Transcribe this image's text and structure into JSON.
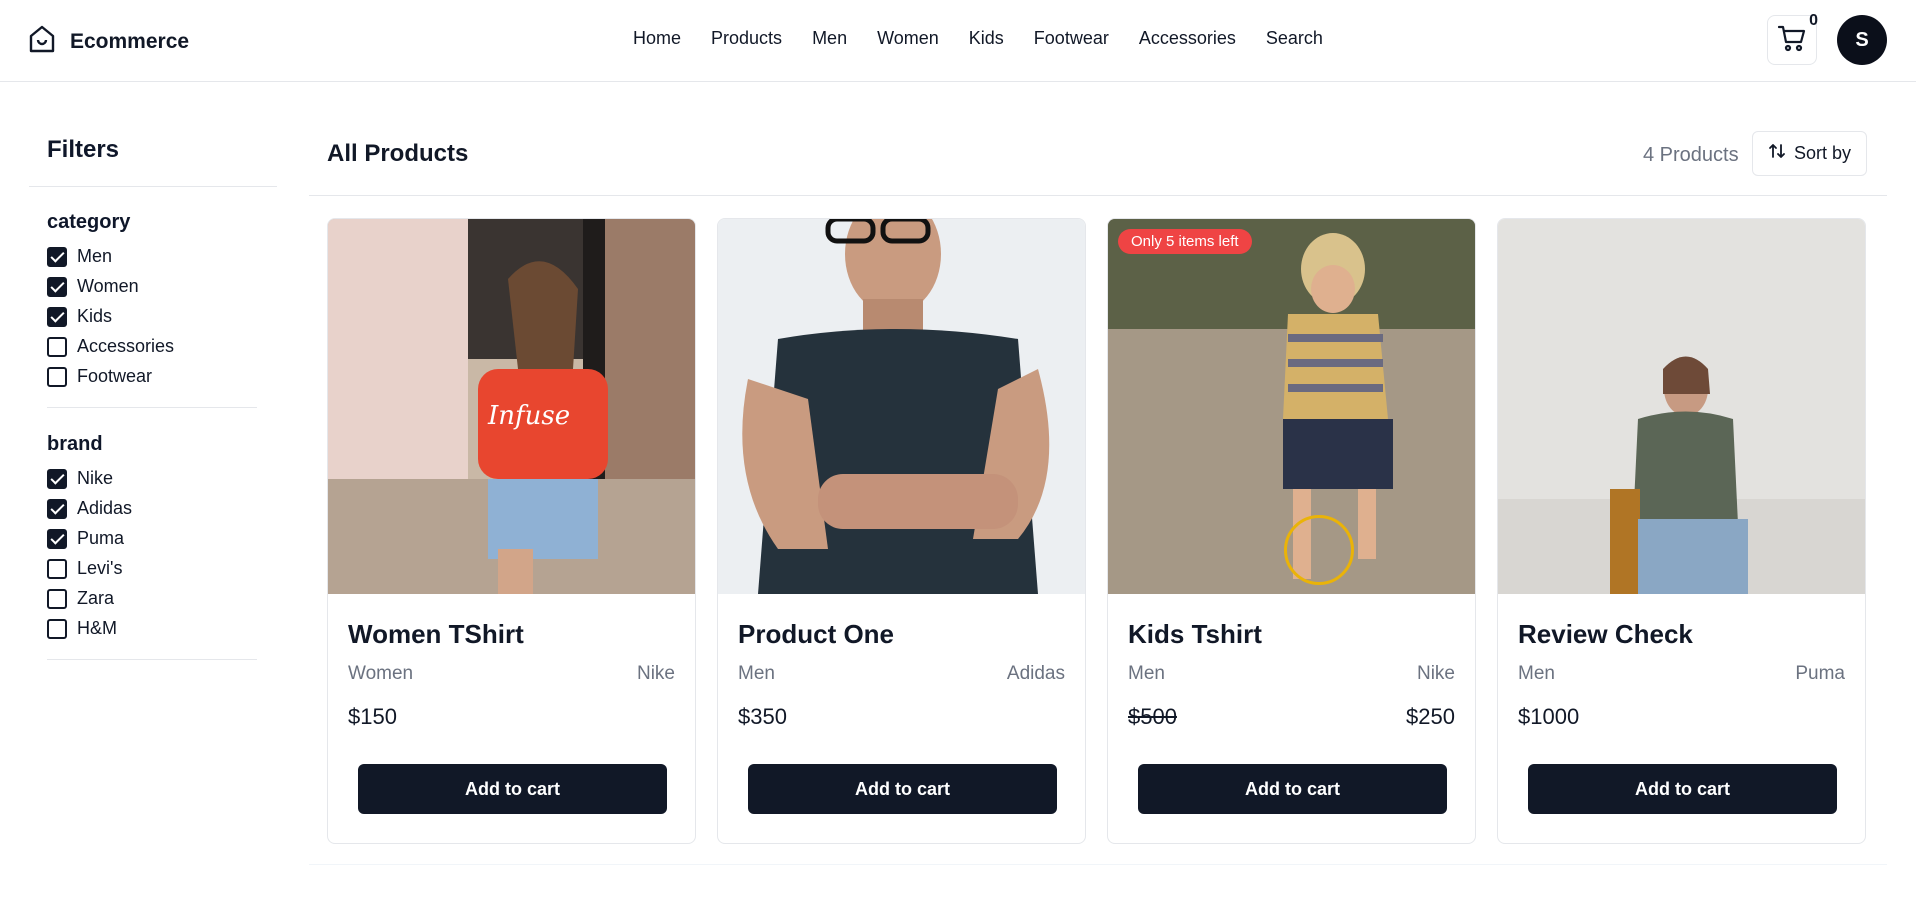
{
  "header": {
    "brand": "Ecommerce",
    "nav": [
      "Home",
      "Products",
      "Men",
      "Women",
      "Kids",
      "Footwear",
      "Accessories",
      "Search"
    ],
    "cart_count": "0",
    "avatar_initial": "S"
  },
  "sidebar": {
    "title": "Filters",
    "category": {
      "title": "category",
      "options": [
        {
          "label": "Men",
          "checked": true
        },
        {
          "label": "Women",
          "checked": true
        },
        {
          "label": "Kids",
          "checked": true
        },
        {
          "label": "Accessories",
          "checked": false
        },
        {
          "label": "Footwear",
          "checked": false
        }
      ]
    },
    "brand": {
      "title": "brand",
      "options": [
        {
          "label": "Nike",
          "checked": true
        },
        {
          "label": "Adidas",
          "checked": true
        },
        {
          "label": "Puma",
          "checked": true
        },
        {
          "label": "Levi's",
          "checked": false
        },
        {
          "label": "Zara",
          "checked": false
        },
        {
          "label": "H&M",
          "checked": false
        }
      ]
    }
  },
  "main": {
    "title": "All Products",
    "count": "4 Products",
    "sort_label": "Sort by"
  },
  "products": [
    {
      "name": "Women TShirt",
      "category": "Women",
      "brand": "Nike",
      "price": "$150",
      "sale_price": "",
      "badge": "",
      "button": "Add to cart"
    },
    {
      "name": "Product One",
      "category": "Men",
      "brand": "Adidas",
      "price": "$350",
      "sale_price": "",
      "badge": "",
      "button": "Add to cart"
    },
    {
      "name": "Kids Tshirt",
      "category": "Men",
      "brand": "Nike",
      "price": "$500",
      "sale_price": "$250",
      "badge": "Only 5 items left",
      "button": "Add to cart"
    },
    {
      "name": "Review Check",
      "category": "Men",
      "brand": "Puma",
      "price": "$1000",
      "sale_price": "",
      "badge": "",
      "button": "Add to cart"
    }
  ],
  "colors": {
    "primary": "#111827",
    "badge": "#ef4444",
    "muted": "#6b7280",
    "border": "#e5e7eb"
  }
}
